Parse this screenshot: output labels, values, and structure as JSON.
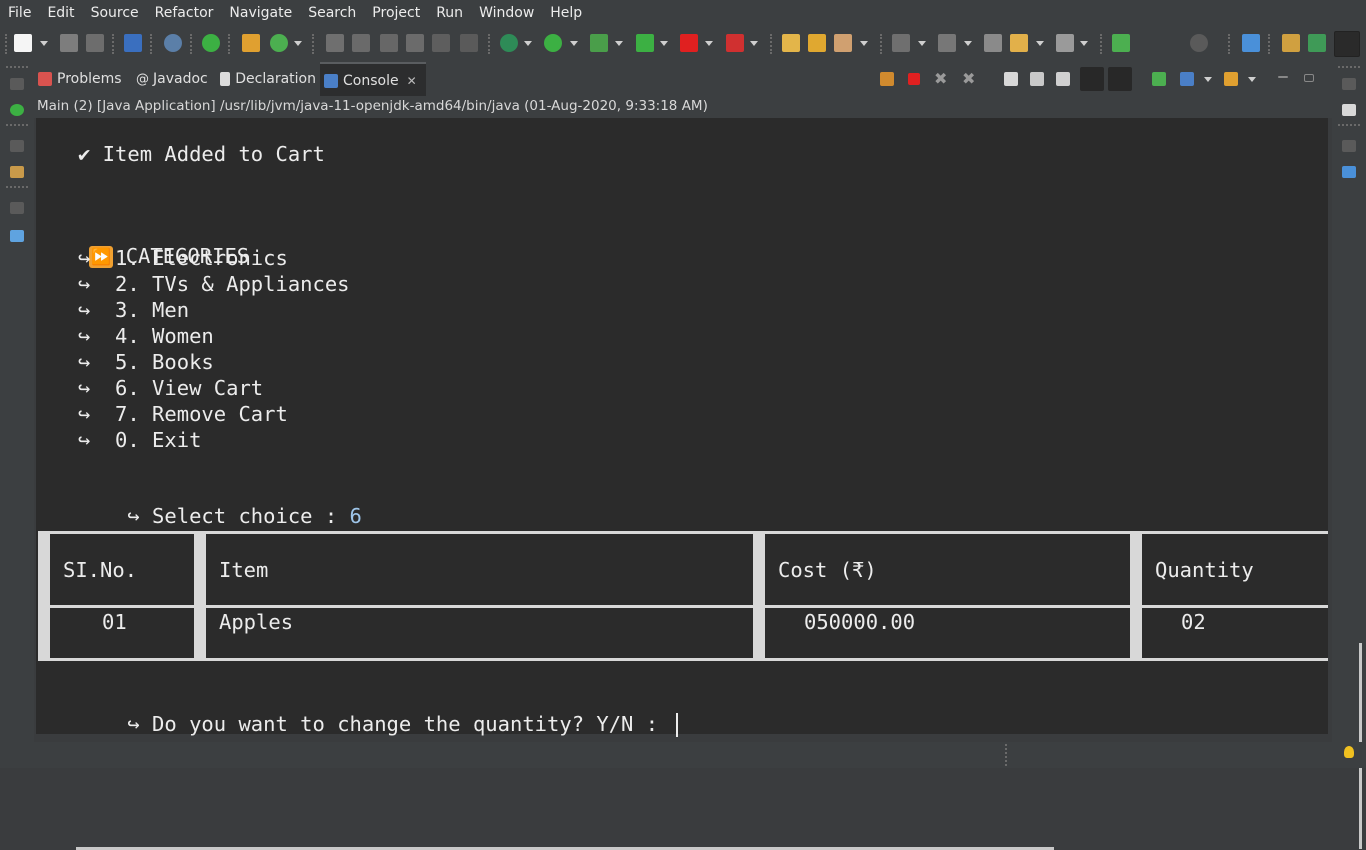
{
  "menu": [
    "File",
    "Edit",
    "Source",
    "Refactor",
    "Navigate",
    "Search",
    "Project",
    "Run",
    "Window",
    "Help"
  ],
  "tabs": [
    {
      "label": "Problems",
      "icon": "problems-icon"
    },
    {
      "label": "Javadoc",
      "icon": "javadoc-icon"
    },
    {
      "label": "Declaration",
      "icon": "declaration-icon"
    },
    {
      "label": "Console",
      "icon": "console-icon",
      "active": true
    }
  ],
  "path": "Main (2) [Java Application] /usr/lib/jvm/java-11-openjdk-amd64/bin/java  (01-Aug-2020, 9:33:18 AM)",
  "console": {
    "added": "✔ Item Added to Cart",
    "categories_title": "CATEGORIES",
    "options": [
      "↪  1. Electronics",
      "↪  2. TVs & Appliances",
      "↪  3. Men",
      "↪  4. Women",
      "↪  5. Books",
      "↪  6. View Cart",
      "↪  7. Remove Cart",
      "↪  0. Exit"
    ],
    "select_prompt": "↪ Select choice : ",
    "select_value": "6",
    "table": {
      "headers": [
        "SI.No.",
        "Item",
        "Cost (₹)",
        "Quantity"
      ],
      "row": [
        "01",
        "Apples",
        "050000.00",
        "02"
      ]
    },
    "change_prompt": "↪ Do you want to change the quantity? Y/N : "
  },
  "colors": {
    "background": "#2b2b2b",
    "chrome": "#3c3f41",
    "input_accent": "#9fc6ea",
    "run_green": "#3cb043",
    "stop_red": "#e02020"
  }
}
